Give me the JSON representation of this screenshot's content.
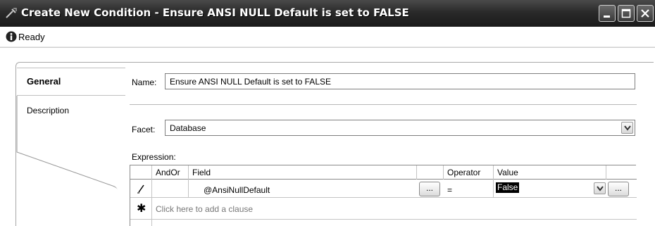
{
  "window": {
    "title": "Create New Condition - Ensure ANSI NULL Default is set to FALSE",
    "icon": "condition-icon"
  },
  "status": {
    "icon": "info-icon",
    "text": "Ready"
  },
  "tabs": [
    {
      "label": "General",
      "selected": true
    },
    {
      "label": "Description",
      "selected": false
    }
  ],
  "form": {
    "name_label": "Name:",
    "name_value": "Ensure ANSI NULL Default is set to FALSE",
    "facet_label": "Facet:",
    "facet_value": "Database",
    "expression_label": "Expression:"
  },
  "grid": {
    "headers": {
      "andor": "AndOr",
      "field": "Field",
      "operator": "Operator",
      "value": "Value"
    },
    "rows": [
      {
        "marker": "edit-pencil-icon",
        "andor": "",
        "field": "@AnsiNullDefault",
        "field_button": "...",
        "operator": "=",
        "value": "False",
        "value_button": "..."
      }
    ],
    "new_row_marker": "✱",
    "add_clause_text": "Click here to add a clause"
  }
}
